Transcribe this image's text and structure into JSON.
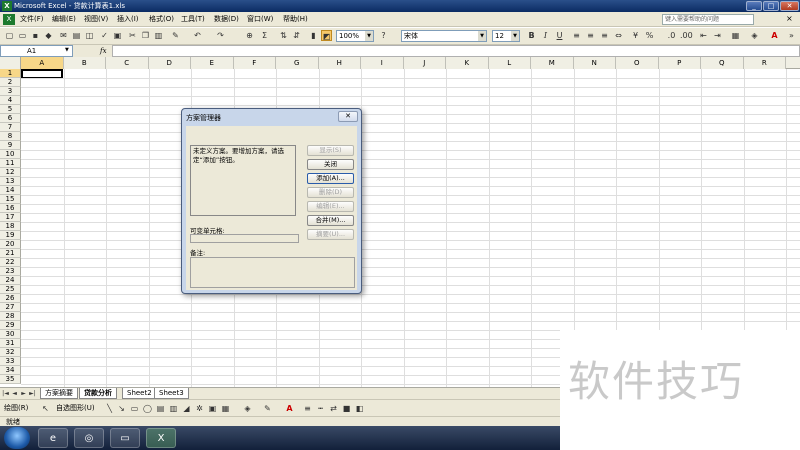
{
  "window": {
    "title": "Microsoft Excel - 贷款计算表1.xls",
    "app_icon": "X",
    "controls": {
      "minimize": "_",
      "restore": "□",
      "close": "✕"
    }
  },
  "menu": {
    "items": [
      "文件(F)",
      "编辑(E)",
      "视图(V)",
      "插入(I)",
      "格式(O)",
      "工具(T)",
      "数据(D)",
      "窗口(W)",
      "帮助(H)"
    ],
    "help_placeholder": "键入需要帮助的问题",
    "doc_close": "×"
  },
  "toolbar": {
    "zoom": "100%",
    "font_name": "宋体",
    "font_size": "12",
    "bold": "B",
    "italic": "I",
    "underline": "U",
    "sum_symbol": "Σ",
    "percent": "%"
  },
  "formula_bar": {
    "cell_ref": "A1",
    "fx": "fx",
    "value": ""
  },
  "grid": {
    "columns": [
      "A",
      "B",
      "C",
      "D",
      "E",
      "F",
      "G",
      "H",
      "I",
      "J",
      "K",
      "L",
      "M",
      "N",
      "O",
      "P",
      "Q",
      "R"
    ],
    "rows": [
      "1",
      "2",
      "3",
      "4",
      "5",
      "6",
      "7",
      "8",
      "9",
      "10",
      "11",
      "12",
      "13",
      "14",
      "15",
      "16",
      "17",
      "18",
      "19",
      "20",
      "21",
      "22",
      "23",
      "24",
      "25",
      "26",
      "27",
      "28",
      "29",
      "30",
      "31",
      "32",
      "33",
      "34",
      "35"
    ],
    "selected_cell": "A1"
  },
  "sheet_tabs": {
    "nav": [
      "|◄",
      "◄",
      "►",
      "►|"
    ],
    "tabs": [
      "方案摘要",
      "贷款分析",
      "Sheet2",
      "Sheet3"
    ],
    "active": "贷款分析"
  },
  "drawing_toolbar": {
    "draw_label": "绘图(R)",
    "autoshapes_label": "自选图形(U)"
  },
  "status": {
    "text": "就绪"
  },
  "dialog": {
    "title": "方案管理器",
    "close": "✕",
    "scenarios_message": "未定义方案。要增加方案，请选定“添加”按钮。",
    "buttons": {
      "show": "显示(S)",
      "close": "关闭",
      "add": "添加(A)...",
      "delete": "删除(D)",
      "edit": "编辑(E)...",
      "merge": "合并(M)...",
      "summary": "摘要(U)..."
    },
    "changing_cells_label": "可变单元格:",
    "comment_label": "备注:"
  },
  "watermark": {
    "text": "软件技巧"
  },
  "colors": {
    "titlebar": "#0b2b63",
    "chrome": "#ece9d8",
    "dialog_frame": "#c8d6ea",
    "active_tab": "#ffffff"
  }
}
